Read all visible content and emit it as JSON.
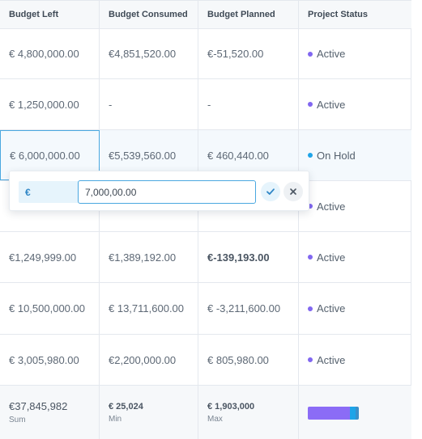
{
  "columns": [
    "Budget Left",
    "Budget Consumed",
    "Budget Planned",
    "Project Status"
  ],
  "rows": [
    {
      "left": "€ 4,800,000.00",
      "consumed": "€4,851,520.00",
      "planned": "€-51,520.00",
      "status": "Active"
    },
    {
      "left": "€ 1,250,000.00",
      "consumed": "-",
      "planned": "-",
      "status": "Active"
    },
    {
      "left": "€ 6,000,000.00",
      "consumed": "€5,539,560.00",
      "planned": "€ 460,440.00",
      "status": "On Hold"
    },
    {
      "left": "",
      "consumed": "",
      "planned": "",
      "status": "Active"
    },
    {
      "left": "€1,249,999.00",
      "consumed": "€1,389,192.00",
      "planned": "€-139,193.00",
      "status": "Active"
    },
    {
      "left": "€ 10,500,000.00",
      "consumed": "€ 13,711,600.00",
      "planned": "€ -3,211,600.00",
      "status": "Active"
    },
    {
      "left": "€ 3,005,980.00",
      "consumed": "€2,200,000.00",
      "planned": "€ 805,980.00",
      "status": "Active"
    }
  ],
  "footer": {
    "sum_value": "€37,845,982",
    "sum_label": "Sum",
    "min_value": "€ 25,024",
    "min_label": "Min",
    "max_value": "€ 1,903,000",
    "max_label": "Max",
    "status_distribution": {
      "active": 0.83,
      "on_hold": 0.1,
      "other": 0.07
    }
  },
  "editor": {
    "currency": "€",
    "value": "7,000,00.00"
  },
  "colors": {
    "active_dot": "#8167f0",
    "on_hold_dot": "#1ea4e8",
    "selection_border": "#4aa8e0"
  },
  "icons": {
    "confirm": "check-icon",
    "cancel": "close-icon"
  }
}
